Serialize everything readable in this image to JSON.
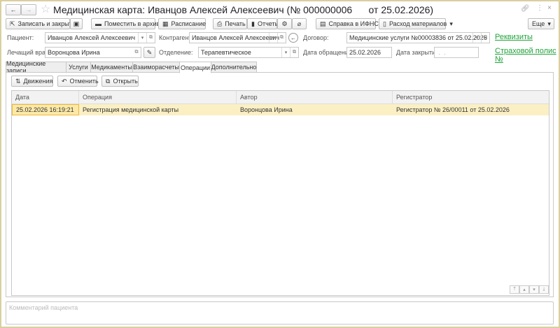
{
  "window": {
    "title": "Медицинская карта: Иванцов Алексей Алексеевич (№ 000000006      от 25.02.2026)"
  },
  "toolbar": {
    "save_close": "Записать и закрыть",
    "archive": "Поместить в архив",
    "schedule": "Расписание",
    "print": "Печать",
    "reports": "Отчеты",
    "ifns": "Справка в ИФНС",
    "materials": "Расход материалов",
    "more": "Еще"
  },
  "form": {
    "patient_label": "Пациент:",
    "patient": "Иванцов Алексей Алексеевич",
    "contractor_label": "Контрагент:",
    "contractor": "Иванцов Алексей Алексеевич",
    "contract_label": "Договор:",
    "contract": "Медицинские услуги №00003836 от 25.02.2026",
    "doctor_label": "Лечащий врач:",
    "doctor": "Воронцова Ирина",
    "department_label": "Отделение:",
    "department": "Терапевтическое",
    "visit_date_label": "Дата обращения:",
    "visit_date": "25.02.2026",
    "close_date_label": "Дата закрытия:",
    "close_date": " .  .",
    "requisites_link": "Реквизиты",
    "policy_link": "Страховой полис №"
  },
  "tabs": [
    "Медицинские записи",
    "Услуги",
    "Медикаменты",
    "Взаиморасчеты",
    "Операции",
    "Дополнительно"
  ],
  "active_tab": "Операции",
  "operations": {
    "buttons": {
      "movements": "Движения",
      "cancel": "Отменить",
      "open": "Открыть"
    },
    "columns": [
      "Дата",
      "Операция",
      "Автор",
      "Регистратор"
    ],
    "rows": [
      [
        "25.02.2026 16:19:21",
        "Регистрация медицинской карты",
        "Воронцова Ирина",
        "Регистратор № 26/00011 от 25.02.2026"
      ]
    ]
  },
  "comment": {
    "placeholder": "Комментарий пациента"
  },
  "colors": {
    "link": "#21a33a",
    "selected_row": "#fbf0c4",
    "window_border": "#d9cf9f"
  }
}
